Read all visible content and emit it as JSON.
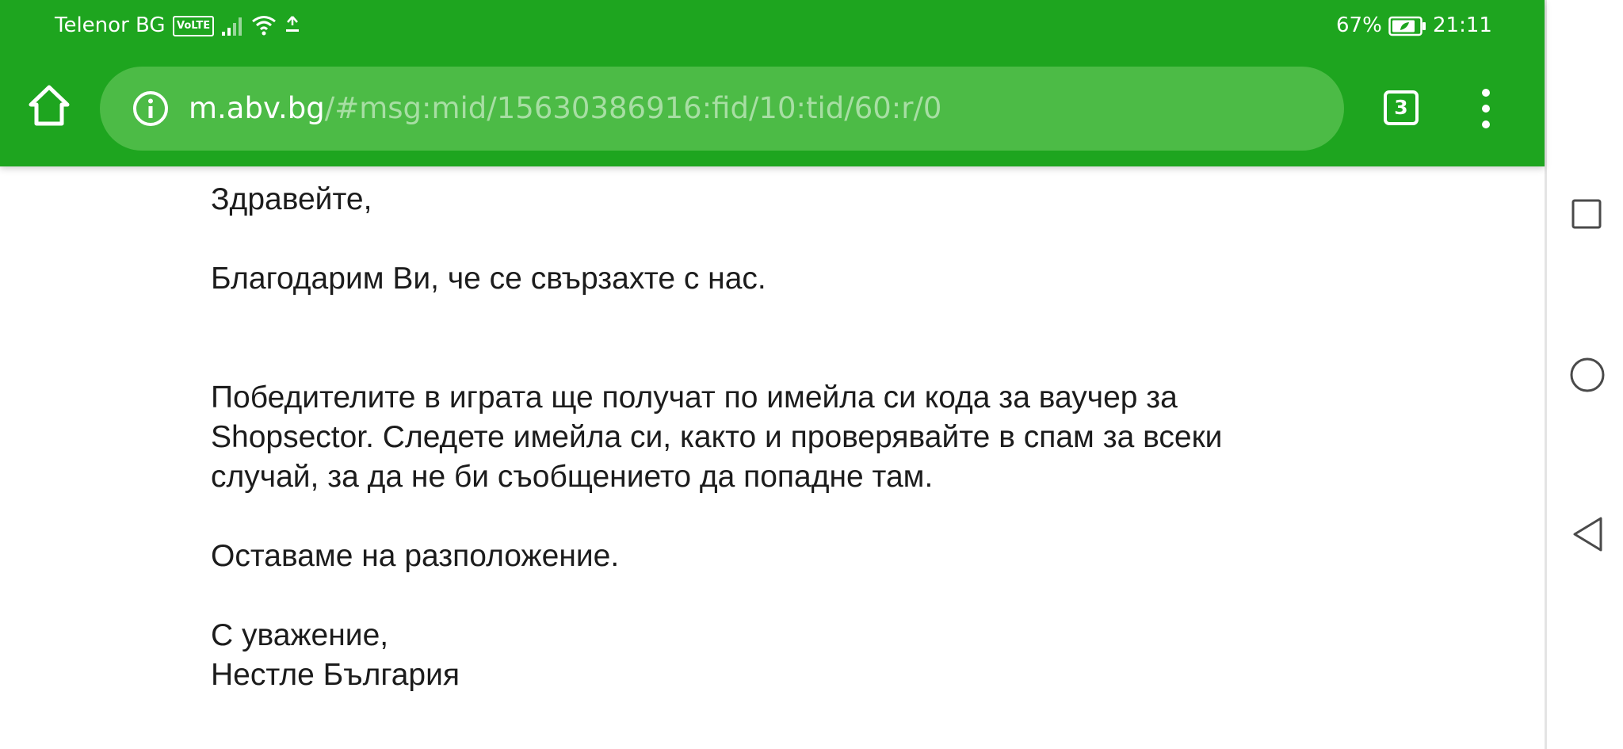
{
  "status_bar": {
    "carrier": "Telenor BG",
    "volte_badge": "VoLTE",
    "battery_percent": "67%",
    "time": "21:11"
  },
  "browser": {
    "url_host": "m.abv.bg",
    "url_path": "/#msg:mid/15630386916:fid/10:tid/60:r/0",
    "tab_count": "3",
    "theme_color": "#1ea51f"
  },
  "email": {
    "greeting": "Здравейте,",
    "thanks": "Благодарим Ви, че се свързахте с нас.",
    "body_line_1": "Победителите в играта ще получат по имейла си кода за ваучер за",
    "body_line_2": "Shopsector. Следете имейла си, както и проверявайте в спам за всеки",
    "body_line_3": "случай, за да не би съобщението да попадне там.",
    "availability": "Оставаме на разположение.",
    "closing": "С уважение,",
    "signature": "Нестле България"
  },
  "icons": {
    "home": "home-icon",
    "info": "info-icon",
    "menu": "more-vertical-icon",
    "nav_recents": "square-icon",
    "nav_home": "circle-icon",
    "nav_back": "triangle-back-icon"
  }
}
